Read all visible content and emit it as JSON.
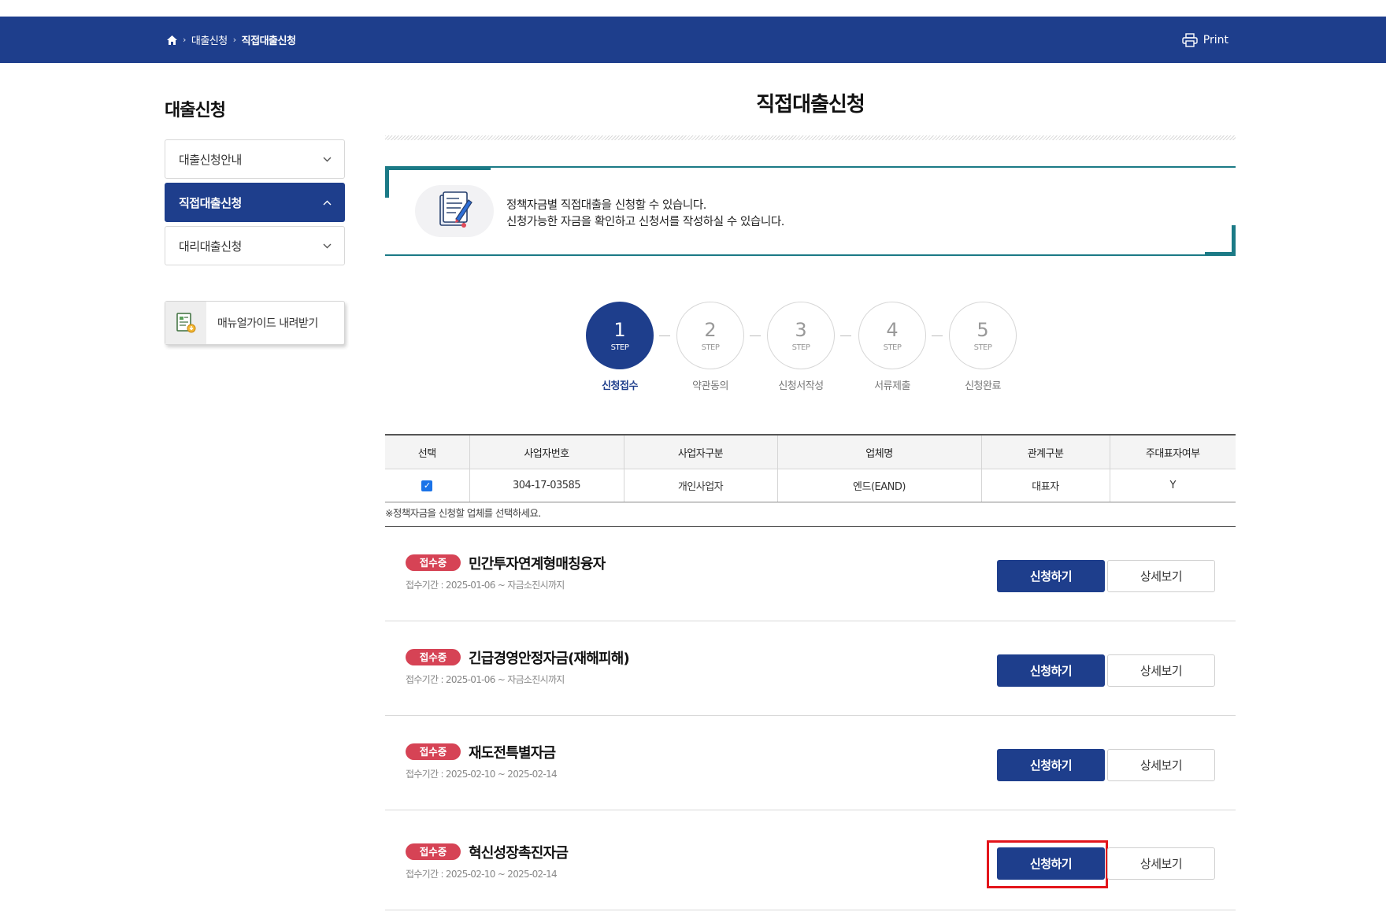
{
  "breadcrumb": {
    "home_icon": "home-icon",
    "items": [
      "대출신청",
      "직접대출신청"
    ]
  },
  "print": {
    "label": "Print",
    "icon": "printer-icon"
  },
  "sidebar": {
    "title": "대출신청",
    "items": [
      {
        "label": "대출신청안내",
        "active": false,
        "chevron": "chevron-down-icon"
      },
      {
        "label": "직접대출신청",
        "active": true,
        "chevron": "chevron-up-icon"
      },
      {
        "label": "대리대출신청",
        "active": false,
        "chevron": "chevron-down-icon"
      }
    ],
    "manual_button": {
      "label": "매뉴얼가이드 내려받기",
      "icon": "document-guide-icon"
    }
  },
  "main": {
    "title": "직접대출신청",
    "notice": {
      "icon": "application-form-icon",
      "lines": [
        "정책자금별 직접대출을 신청할 수 있습니다.",
        "신청가능한 자금을 확인하고 신청서를 작성하실 수 있습니다."
      ]
    },
    "steps": [
      {
        "num": "1",
        "step": "STEP",
        "label": "신청접수",
        "active": true
      },
      {
        "num": "2",
        "step": "STEP",
        "label": "약관동의",
        "active": false
      },
      {
        "num": "3",
        "step": "STEP",
        "label": "신청서작성",
        "active": false
      },
      {
        "num": "4",
        "step": "STEP",
        "label": "서류제출",
        "active": false
      },
      {
        "num": "5",
        "step": "STEP",
        "label": "신청완료",
        "active": false
      }
    ],
    "company_table": {
      "columns": [
        "선택",
        "사업자번호",
        "사업자구분",
        "업체명",
        "관계구분",
        "주대표자여부"
      ],
      "rows": [
        {
          "checked": true,
          "biz_no": "304-17-03585",
          "biz_type": "개인사업자",
          "company": "엔드(EAND)",
          "relation": "대표자",
          "main_rep": "Y"
        }
      ],
      "note": "※정책자금을 신청할 업체를 선택하세요."
    },
    "funds": [
      {
        "badge": "접수중",
        "title": "민간투자연계형매칭융자",
        "period": "접수기간 : 2025-01-06 ~ 자금소진시까지",
        "apply_label": "신청하기",
        "detail_label": "상세보기",
        "highlighted": false
      },
      {
        "badge": "접수중",
        "title": "긴급경영안정자금(재해피해)",
        "period": "접수기간 : 2025-01-06 ~ 자금소진시까지",
        "apply_label": "신청하기",
        "detail_label": "상세보기",
        "highlighted": false
      },
      {
        "badge": "접수중",
        "title": "재도전특별자금",
        "period": "접수기간 : 2025-02-10 ~ 2025-02-14",
        "apply_label": "신청하기",
        "detail_label": "상세보기",
        "highlighted": false
      },
      {
        "badge": "접수중",
        "title": "혁신성장촉진자금",
        "period": "접수기간 : 2025-02-10 ~ 2025-02-14",
        "apply_label": "신청하기",
        "detail_label": "상세보기",
        "highlighted": true
      }
    ]
  },
  "colors": {
    "primary": "#1e3e8c",
    "teal": "#1b7a86",
    "badge": "#d64355",
    "highlight": "#e3151b"
  }
}
